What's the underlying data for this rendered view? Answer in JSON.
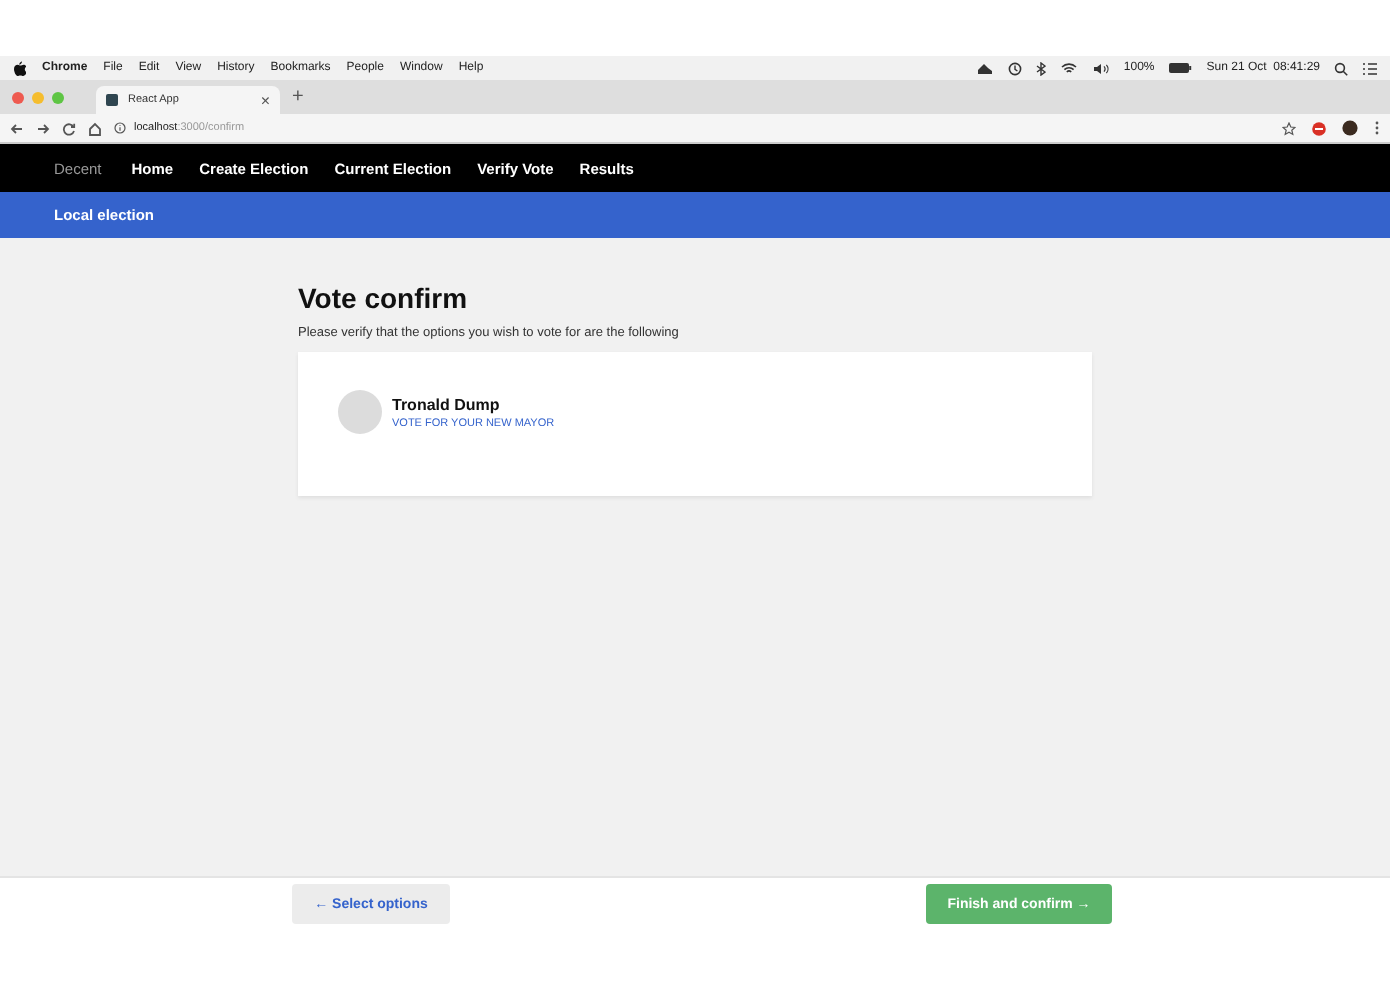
{
  "menu_bar": {
    "app": "Chrome",
    "items": [
      "File",
      "Edit",
      "View",
      "History",
      "Bookmarks",
      "People",
      "Window",
      "Help"
    ],
    "battery": "100%",
    "clock": "Sun 21 Oct  08:41:29"
  },
  "browser": {
    "tab_title": "React App",
    "tab_close": "×",
    "new_tab": "+",
    "url_host": "localhost",
    "url_path": ":3000/confirm"
  },
  "nav": {
    "brand": "Decent",
    "items": [
      "Home",
      "Create Election",
      "Current Election",
      "Verify Vote",
      "Results"
    ]
  },
  "sub_bar": {
    "title": "Local election"
  },
  "page": {
    "heading": "Vote confirm",
    "intro": "Please verify that the options you wish to vote for are the following",
    "choices": [
      {
        "name": "Tronald Dump",
        "position": "VOTE FOR YOUR NEW MAYOR"
      }
    ]
  },
  "footer": {
    "back_button": "← Select options",
    "confirm_button": "Finish and confirm →"
  }
}
